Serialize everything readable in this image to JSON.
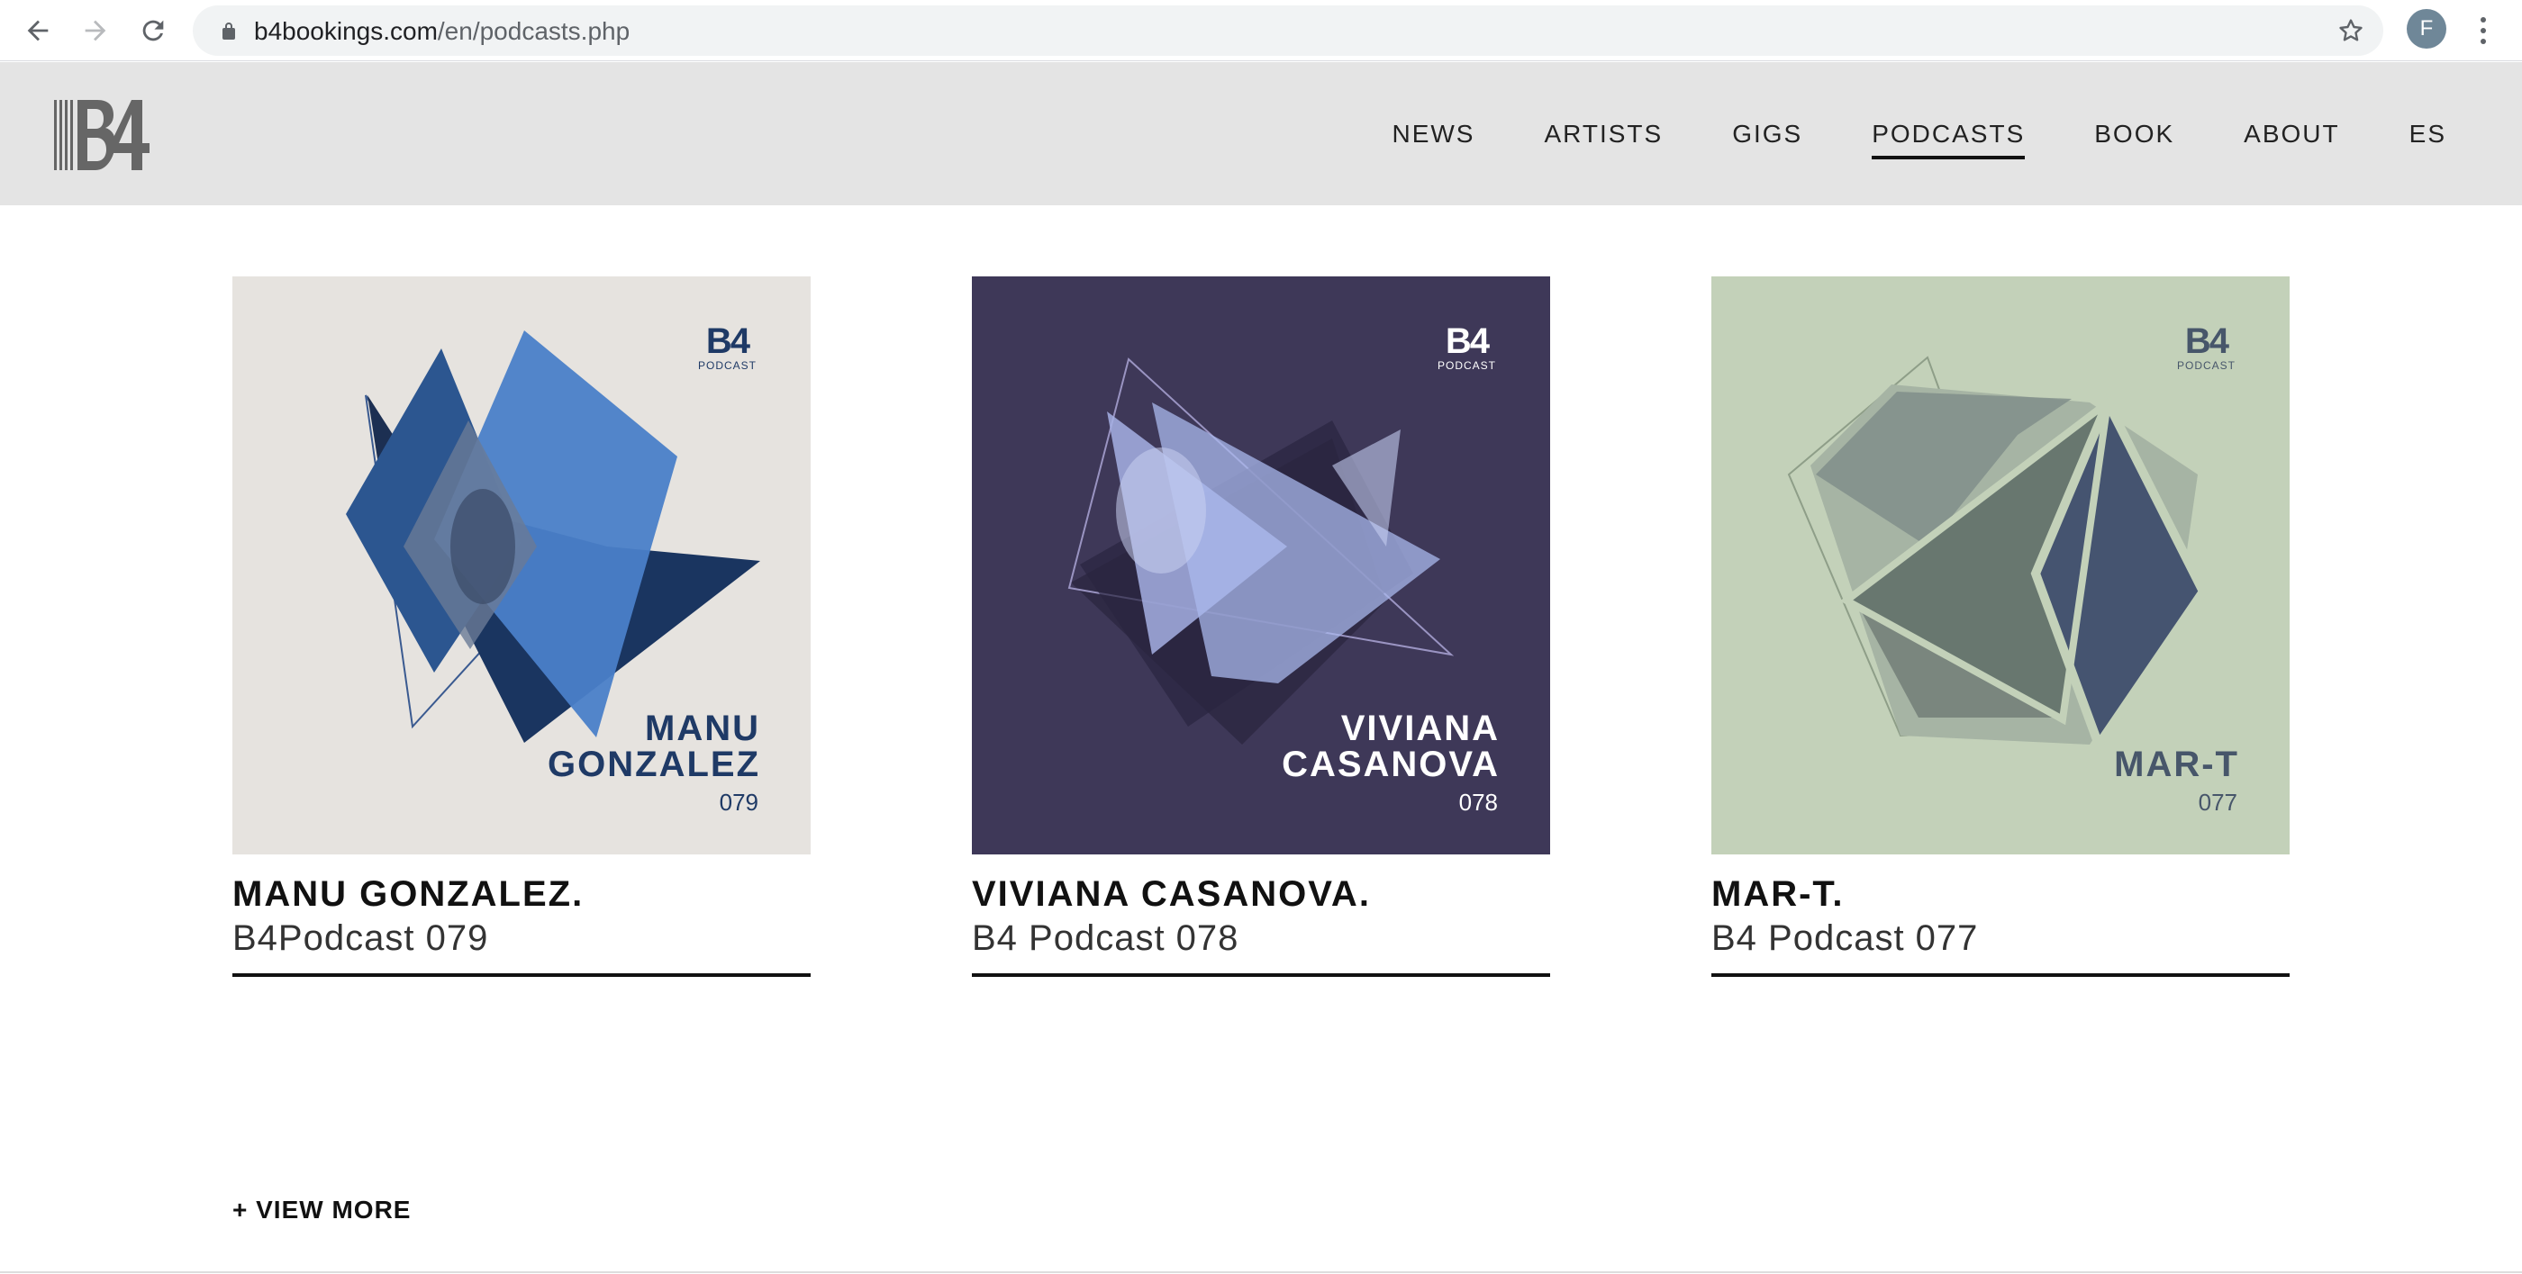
{
  "browser": {
    "url_host": "b4bookings.com",
    "url_path": "/en/podcasts.php",
    "profile_initial": "F"
  },
  "site": {
    "logo_text": "B4",
    "nav": [
      {
        "label": "NEWS"
      },
      {
        "label": "ARTISTS"
      },
      {
        "label": "GIGS"
      },
      {
        "label": "PODCASTS",
        "active": true
      },
      {
        "label": "BOOK"
      },
      {
        "label": "ABOUT"
      },
      {
        "label": "ES"
      }
    ]
  },
  "podcasts": [
    {
      "cover_badge": "B4",
      "cover_badge_sub": "PODCAST",
      "cover_name_line1": "MANU",
      "cover_name_line2": "GONZALEZ",
      "cover_number": "079",
      "title": "MANU GONZALEZ.",
      "subtitle": "B4Podcast 079",
      "bg_color": "#e6e3df",
      "text_color": "#1f3a66"
    },
    {
      "cover_badge": "B4",
      "cover_badge_sub": "PODCAST",
      "cover_name_line1": "VIVIANA",
      "cover_name_line2": "CASANOVA",
      "cover_number": "078",
      "title": "VIVIANA CASANOVA.",
      "subtitle": "B4 Podcast 078",
      "bg_color": "#3e3858",
      "text_color": "#ffffff"
    },
    {
      "cover_badge": "B4",
      "cover_badge_sub": "PODCAST",
      "cover_name_line1": "",
      "cover_name_line2": "MAR-T",
      "cover_number": "077",
      "title": "MAR-T.",
      "subtitle": "B4 Podcast 077",
      "bg_color": "#c3d1b9",
      "text_color": "#47566a"
    }
  ],
  "view_more_label": "+ VIEW MORE"
}
